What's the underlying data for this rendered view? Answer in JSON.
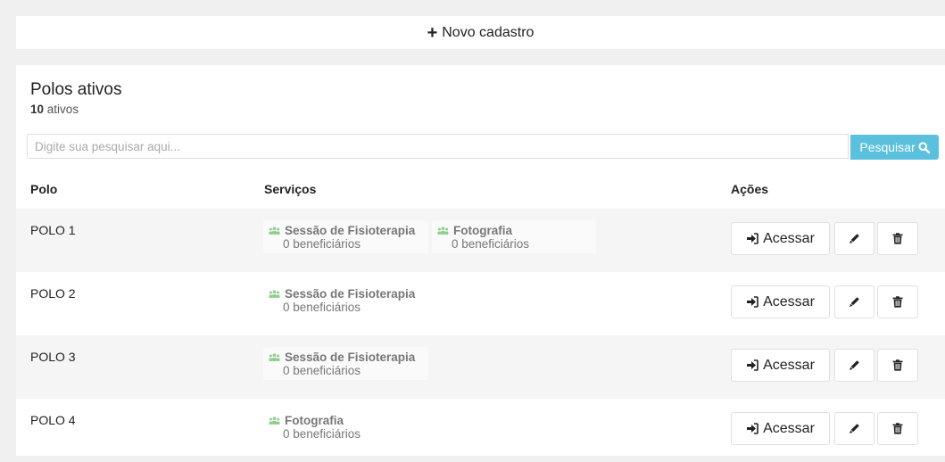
{
  "new_button": {
    "label": "Novo cadastro"
  },
  "panel": {
    "title": "Polos ativos",
    "count": "10",
    "count_suffix": "ativos"
  },
  "search": {
    "placeholder": "Digite sua pesquisar aqui...",
    "button_label": "Pesquisar"
  },
  "table": {
    "headers": {
      "polo": "Polo",
      "servicos": "Serviços",
      "acoes": "Ações"
    },
    "access_label": "Acessar",
    "rows": [
      {
        "name": "POLO 1",
        "services": [
          {
            "name": "Sessão de Fisioterapia",
            "count": "0 beneficiários"
          },
          {
            "name": "Fotografia",
            "count": "0 beneficiários"
          }
        ]
      },
      {
        "name": "POLO 2",
        "services": [
          {
            "name": "Sessão de Fisioterapia",
            "count": "0 beneficiários"
          }
        ]
      },
      {
        "name": "POLO 3",
        "services": [
          {
            "name": "Sessão de Fisioterapia",
            "count": "0 beneficiários"
          }
        ]
      },
      {
        "name": "POLO 4",
        "services": [
          {
            "name": "Fotografia",
            "count": "0 beneficiários"
          }
        ]
      }
    ]
  },
  "colors": {
    "accent": "#5bc0de",
    "background": "#f0f0f0",
    "row_alt": "#f5f5f5"
  },
  "icons": {
    "new": "plus-icon",
    "search": "search-icon",
    "service": "users-icon",
    "access": "sign-in-icon",
    "edit": "pencil-icon",
    "delete": "trash-icon"
  }
}
